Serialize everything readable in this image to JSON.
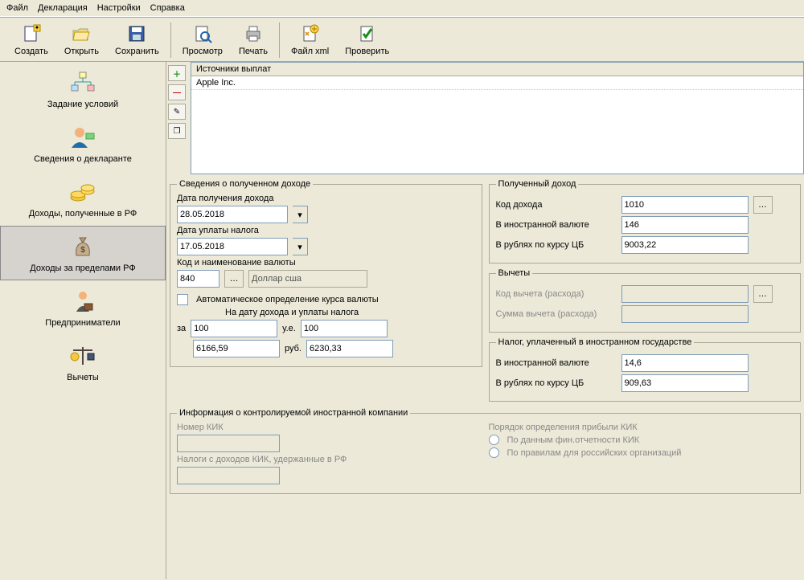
{
  "menu": {
    "file": "Файл",
    "declaration": "Декларация",
    "settings": "Настройки",
    "help": "Справка"
  },
  "toolbar": {
    "create": "Создать",
    "open": "Открыть",
    "save": "Сохранить",
    "preview": "Просмотр",
    "print": "Печать",
    "filexml": "Файл xml",
    "check": "Проверить"
  },
  "sidebar": {
    "conditions": "Задание условий",
    "declarant": "Сведения о декларанте",
    "income_rf": "Доходы, полученные в РФ",
    "income_abroad": "Доходы за пределами РФ",
    "entrepreneurs": "Предприниматели",
    "deductions": "Вычеты"
  },
  "sources": {
    "header": "Источники выплат",
    "row0": "Apple Inc."
  },
  "income": {
    "legend": "Сведения о полученном доходе",
    "date_received_label": "Дата получения дохода",
    "date_received": "28.05.2018",
    "date_tax_label": "Дата уплаты налога",
    "date_tax": "17.05.2018",
    "currency_code_label": "Код и наименование валюты",
    "currency_code": "840",
    "currency_name": "Доллар сша",
    "auto_rate": "Автоматическое определение курса валюты",
    "rate_sub": "На дату дохода и уплаты налога",
    "za": "за",
    "ue": "у.е.",
    "rub": "руб.",
    "per": "100",
    "per2": "100",
    "rate1": "6166,59",
    "rate2": "6230,33"
  },
  "received": {
    "legend": "Полученный доход",
    "code_label": "Код дохода",
    "code": "1010",
    "foreign_label": "В иностранной валюте",
    "foreign": "146",
    "rub_label": "В рублях по курсу ЦБ",
    "rub": "9003,22"
  },
  "ded": {
    "legend": "Вычеты",
    "code_label": "Код вычета (расхода)",
    "code": "",
    "sum_label": "Сумма вычета (расхода)",
    "sum": ""
  },
  "tax": {
    "legend": "Налог, уплаченный в иностранном государстве",
    "foreign_label": "В иностранной валюте",
    "foreign": "14,6",
    "rub_label": "В рублях по курсу ЦБ",
    "rub": "909,63"
  },
  "kik": {
    "legend": "Информация о контролируемой иностранной компании",
    "num_label": "Номер КИК",
    "num": "",
    "taxes_label": "Налоги с доходов КИК, удержанные в РФ",
    "taxes": "",
    "order_label": "Порядок определения прибыли КИК",
    "r1": "По данным фин.отчетности КИК",
    "r2": "По правилам для российских организаций"
  }
}
